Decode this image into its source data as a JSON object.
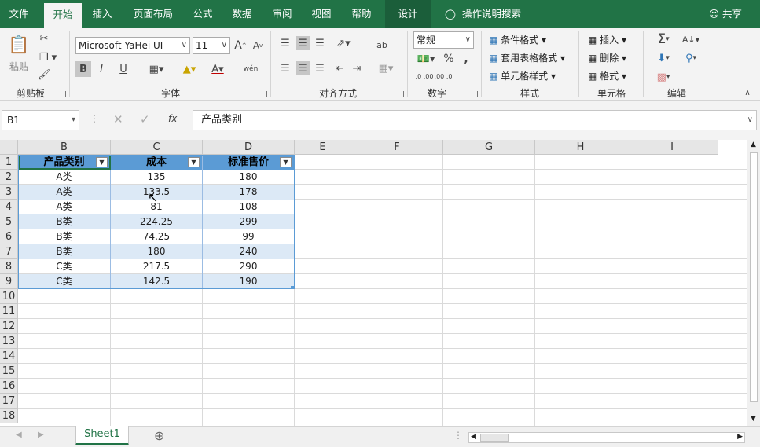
{
  "ribbon_tabs": [
    "文件",
    "开始",
    "插入",
    "页面布局",
    "公式",
    "数据",
    "审阅",
    "视图",
    "帮助",
    "设计"
  ],
  "active_tab": "开始",
  "tell_me": "操作说明搜索",
  "share": "共享",
  "clipboard": {
    "paste": "粘贴",
    "label": "剪贴板"
  },
  "font": {
    "name": "Microsoft YaHei UI",
    "size": "11",
    "label": "字体",
    "bold": "B",
    "italic": "I",
    "underline": "U",
    "wen": "wén"
  },
  "alignment": {
    "label": "对齐方式"
  },
  "number": {
    "format": "常规",
    "percent": "%",
    "comma": ",",
    "label": "数字",
    "dec_inc": ".0 .00",
    "dec_dec": ".00 .0"
  },
  "styles": {
    "cond": "条件格式",
    "table": "套用表格格式",
    "cell": "单元格样式",
    "label": "样式"
  },
  "cells": {
    "insert": "插入",
    "delete": "删除",
    "format": "格式",
    "label": "单元格"
  },
  "editing": {
    "label": "编辑"
  },
  "name_box": "B1",
  "formula": "产品类别",
  "fx": "fx",
  "columns": [
    "B",
    "C",
    "D",
    "E",
    "F",
    "G",
    "H",
    "I"
  ],
  "rows": [
    "1",
    "2",
    "3",
    "4",
    "5",
    "6",
    "7",
    "8",
    "9",
    "10",
    "11",
    "12",
    "13",
    "14",
    "15",
    "16",
    "17",
    "18"
  ],
  "table": {
    "headers": [
      "产品类别",
      "成本",
      "标准售价"
    ],
    "rows": [
      [
        "A类",
        "135",
        "180"
      ],
      [
        "A类",
        "133.5",
        "178"
      ],
      [
        "A类",
        "81",
        "108"
      ],
      [
        "B类",
        "224.25",
        "299"
      ],
      [
        "B类",
        "74.25",
        "99"
      ],
      [
        "B类",
        "180",
        "240"
      ],
      [
        "C类",
        "217.5",
        "290"
      ],
      [
        "C类",
        "142.5",
        "190"
      ]
    ]
  },
  "sheet": "Sheet1",
  "colors": {
    "accent": "#217346",
    "table_header": "#5b9bd5",
    "band": "#dce9f6"
  }
}
